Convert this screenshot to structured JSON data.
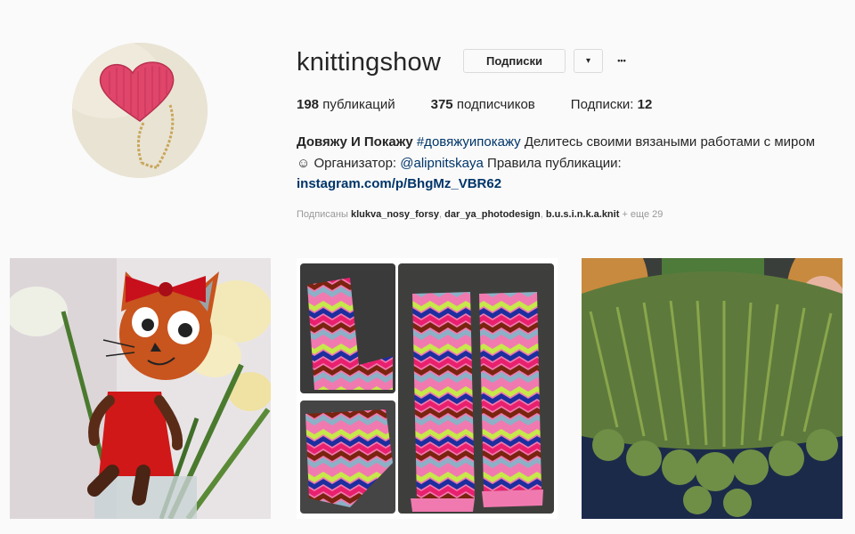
{
  "profile": {
    "username": "knittingshow",
    "follow_button_label": "Подписки",
    "dropdown_glyph": "▾",
    "more_glyph": "•••",
    "avatar_icon": "crochet-heart-brooch"
  },
  "stats": {
    "posts_count": "198",
    "posts_label": " публикаций",
    "followers_count": "375",
    "followers_label": " подписчиков",
    "following_label": "Подписки: ",
    "following_count": "12"
  },
  "bio": {
    "full_name": "Довяжу И Покажу",
    "hashtag": "#довяжуипокажу",
    "text_1": " Делитесь своими вязаными работами с миром",
    "emoji": "☺",
    "text_2": " Организатор: ",
    "mention": "@alipnitskaya",
    "text_3": " Правила публикации:",
    "url": "instagram.com/p/BhgMz_VBR62"
  },
  "followed_by": {
    "prefix": "Подписаны ",
    "user_1": "klukva_nosy_forsy",
    "sep_1": ", ",
    "user_2": "dar_ya_photodesign",
    "sep_2": ", ",
    "user_3": "b.u.s.i.n.k.a.knit",
    "suffix": " + еще 29"
  },
  "posts": [
    {
      "subject": "crochet-cat-toy-red-dress"
    },
    {
      "subject": "crochet-zigzag-slippers-collage"
    },
    {
      "subject": "crochet-green-collar"
    }
  ],
  "colors": {
    "text": "#262626",
    "link": "#003569",
    "muted": "#999999",
    "border": "#dbdbdb",
    "background": "#fafafa"
  }
}
